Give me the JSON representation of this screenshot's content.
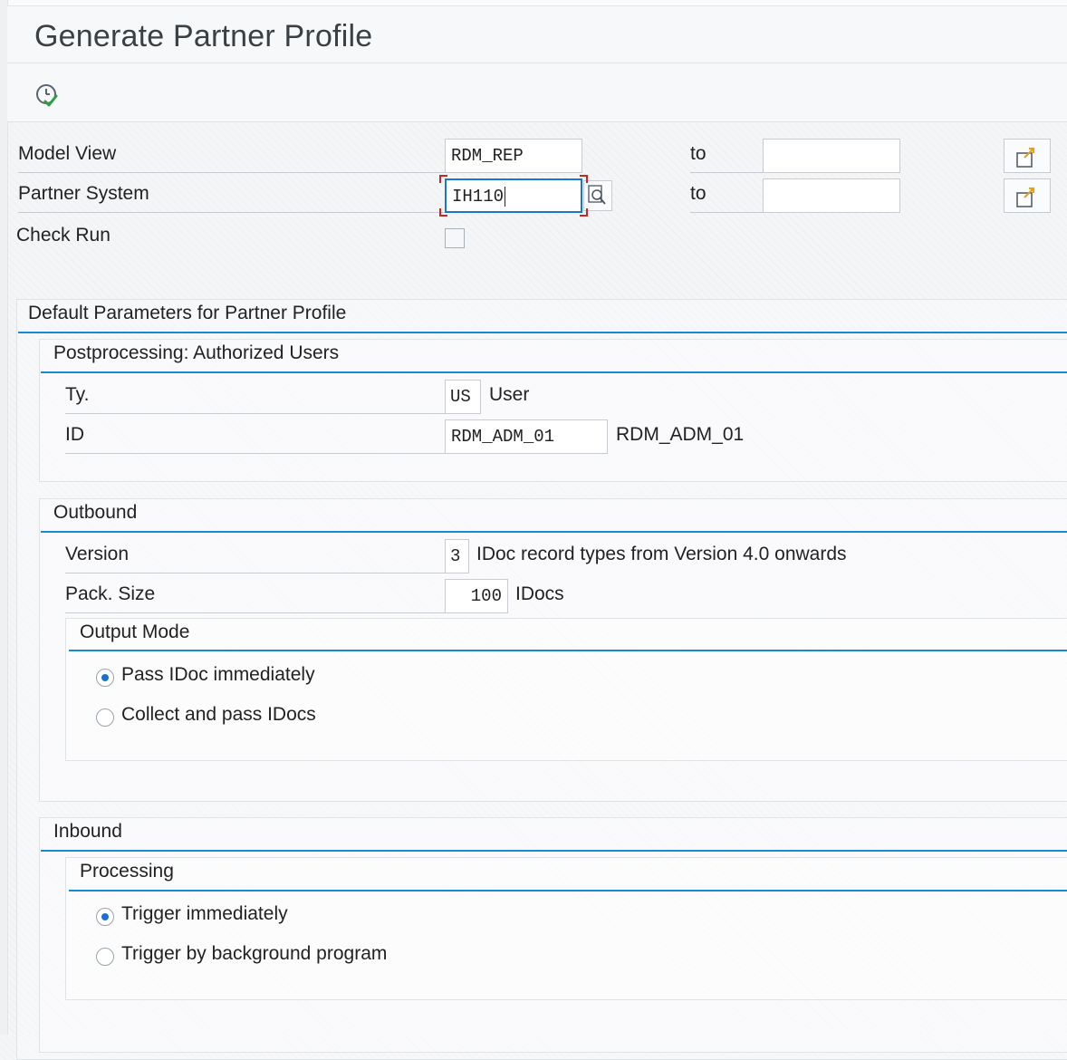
{
  "window": {
    "title": "Generate Partner Profile"
  },
  "toolbar": {
    "execute_icon": "execute-clock-check-icon"
  },
  "selection": {
    "model_view": {
      "label": "Model View",
      "value": "RDM_REP",
      "to_label": "to",
      "to_value": ""
    },
    "partner_system": {
      "label": "Partner System",
      "value": "IH110",
      "to_label": "to",
      "to_value": ""
    },
    "check_run": {
      "label": "Check Run",
      "checked": false
    }
  },
  "defaults": {
    "title": "Default Parameters for Partner Profile",
    "postprocessing": {
      "title": "Postprocessing: Authorized Users",
      "type": {
        "label": "Ty.",
        "value": "US",
        "text": "User"
      },
      "id": {
        "label": "ID",
        "value": "RDM_ADM_01",
        "text": "RDM_ADM_01"
      }
    },
    "outbound": {
      "title": "Outbound",
      "version": {
        "label": "Version",
        "value": "3",
        "text": "IDoc record types from Version 4.0 onwards"
      },
      "pack_size": {
        "label": "Pack. Size",
        "value": "100",
        "text": "IDocs"
      },
      "output_mode": {
        "title": "Output Mode",
        "options": [
          {
            "label": "Pass IDoc immediately",
            "selected": true
          },
          {
            "label": "Collect and pass IDocs",
            "selected": false
          }
        ]
      }
    },
    "inbound": {
      "title": "Inbound",
      "processing": {
        "title": "Processing",
        "options": [
          {
            "label": "Trigger immediately",
            "selected": true
          },
          {
            "label": "Trigger by background program",
            "selected": false
          }
        ]
      }
    }
  },
  "colors": {
    "accent": "#1a8ad0",
    "focus": "#1976d2",
    "icon_arrow": "#e8a21a",
    "icon_check": "#2e9e3e"
  }
}
